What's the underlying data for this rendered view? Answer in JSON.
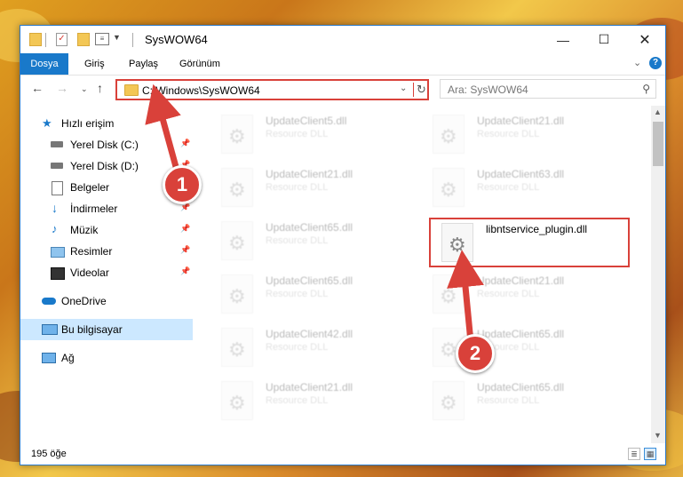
{
  "window": {
    "title": "SysWOW64"
  },
  "ribbon": {
    "tabs": [
      "Dosya",
      "Giriş",
      "Paylaş",
      "Görünüm"
    ],
    "help_label": "?"
  },
  "nav": {
    "address": "C:\\Windows\\SysWOW64",
    "search_placeholder": "Ara: SysWOW64"
  },
  "sidebar": {
    "items": [
      {
        "label": "Hızlı erişim",
        "icon": "star-icon",
        "pinned": false
      },
      {
        "label": "Yerel Disk (C:)",
        "icon": "drive-icon",
        "pinned": true
      },
      {
        "label": "Yerel Disk (D:)",
        "icon": "drive-icon",
        "pinned": true
      },
      {
        "label": "Belgeler",
        "icon": "documents-icon",
        "pinned": true
      },
      {
        "label": "İndirmeler",
        "icon": "download-icon",
        "pinned": true
      },
      {
        "label": "Müzik",
        "icon": "music-icon",
        "pinned": true
      },
      {
        "label": "Resimler",
        "icon": "pictures-icon",
        "pinned": true
      },
      {
        "label": "Videolar",
        "icon": "video-icon",
        "pinned": true
      },
      {
        "label": "OneDrive",
        "icon": "cloud-icon",
        "pinned": false
      },
      {
        "label": "Bu bilgisayar",
        "icon": "computer-icon",
        "pinned": false,
        "selected": true
      },
      {
        "label": "Ağ",
        "icon": "network-icon",
        "pinned": false
      }
    ]
  },
  "files": [
    {
      "name": "UpdateClient5.dll",
      "type": "Resource DLL",
      "faded": true
    },
    {
      "name": "UpdateClient21.dll",
      "type": "Resource DLL",
      "faded": true
    },
    {
      "name": "UpdateClient21.dll",
      "type": "Resource DLL",
      "faded": true
    },
    {
      "name": "UpdateClient63.dll",
      "type": "Resource DLL",
      "faded": true
    },
    {
      "name": "UpdateClient65.dll",
      "type": "Resource DLL",
      "faded": true
    },
    {
      "name": "libntservice_plugin.dll",
      "type": "",
      "faded": false
    },
    {
      "name": "UpdateClient65.dll",
      "type": "Resource DLL",
      "faded": true
    },
    {
      "name": "UpdateClient21.dll",
      "type": "Resource DLL",
      "faded": true
    },
    {
      "name": "UpdateClient42.dll",
      "type": "Resource DLL",
      "faded": true
    },
    {
      "name": "UpdateClient65.dll",
      "type": "Resource DLL",
      "faded": true
    },
    {
      "name": "UpdateClient21.dll",
      "type": "Resource DLL",
      "faded": true
    },
    {
      "name": "UpdateClient65.dll",
      "type": "Resource DLL",
      "faded": true
    }
  ],
  "status": {
    "count": "195 öğe"
  },
  "annotations": {
    "badge1": "1",
    "badge2": "2"
  },
  "colors": {
    "accent": "#1979ca",
    "highlight": "#d9413a",
    "selection": "#cce8ff"
  }
}
